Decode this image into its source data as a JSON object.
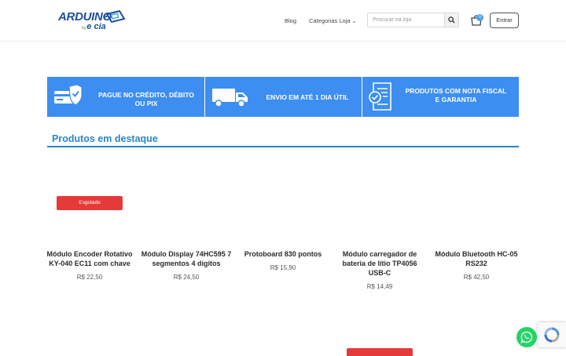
{
  "header": {
    "logo_text": "ARDUINO",
    "logo_sub_small": "by",
    "logo_sub": "e cia",
    "nav": {
      "blog": "Blog",
      "categories": "Categorias Loja"
    },
    "search": {
      "placeholder": "Procurar na loja"
    },
    "cart_count": "0",
    "login_label": "Entrar"
  },
  "banner": {
    "items": [
      {
        "text_line1": "PAGUE NO CRÉDITO, DÉBITO",
        "text_line2": "OU PIX",
        "icon": "card-check-icon"
      },
      {
        "text_line1": "ENVIO EM ATÉ 1 DIA ÚTIL",
        "text_line2": "",
        "icon": "truck-icon"
      },
      {
        "text_line1": "PRODUTOS COM NOTA FISCAL",
        "text_line2": "E GARANTIA",
        "icon": "invoice-icon"
      }
    ],
    "color": "#3d8ef0"
  },
  "featured": {
    "title": "Produtos em destaque",
    "sold_out_label": "Esgotado",
    "products": [
      {
        "name": "Módulo Encoder Rotativo KY-040 EC11 com chave",
        "price": "R$ 22,50"
      },
      {
        "name": "Módulo Display 74HC595 7 segmentos 4 dígitos",
        "price": "R$ 24,50"
      },
      {
        "name": "Protoboard 830 pontos",
        "price": "R$ 15,90"
      },
      {
        "name": "Módulo carregador de bateria de lítio TP4056 USB-C",
        "price": "R$ 14,49"
      },
      {
        "name": "Módulo Bluetooth HC-05 RS232",
        "price": "R$ 42,50"
      }
    ]
  },
  "colors": {
    "accent": "#2a86c9",
    "sold_out": "#e53a3a",
    "whatsapp": "#25d366"
  }
}
